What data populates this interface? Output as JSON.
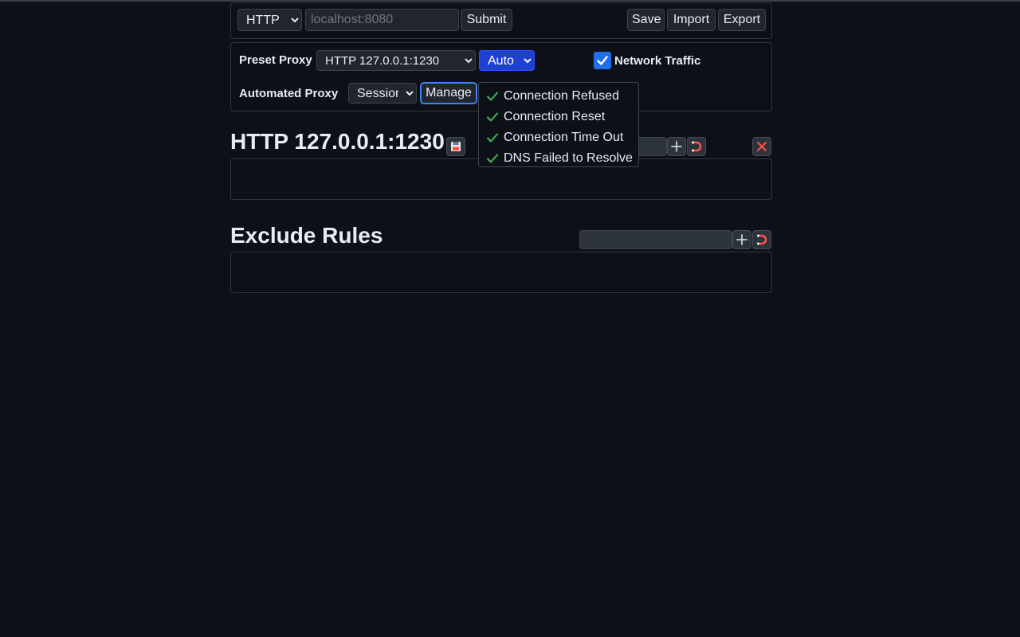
{
  "toolbar": {
    "protocol_selected": "HTTP",
    "host_placeholder": "localhost:8080",
    "host_value": "",
    "submit_label": "Submit",
    "save_label": "Save",
    "import_label": "Import",
    "export_label": "Export"
  },
  "settings": {
    "preset_proxy_label": "Preset Proxy",
    "preset_proxy_selected": "HTTP 127.0.0.1:1230",
    "mode_selected": "Auto",
    "network_traffic_label": "Network Traffic",
    "network_traffic_checked": true,
    "automated_proxy_label": "Automated Proxy",
    "automated_proxy_selected": "Session",
    "manage_label": "Manage"
  },
  "manage_menu": {
    "items": [
      {
        "label": "Connection Refused",
        "checked": true
      },
      {
        "label": "Connection Reset",
        "checked": true
      },
      {
        "label": "Connection Time Out",
        "checked": true
      },
      {
        "label": "DNS Failed to Resolve",
        "checked": true
      }
    ]
  },
  "proxy_section": {
    "title": "HTTP 127.0.0.1:1230"
  },
  "exclude_section": {
    "title": "Exclude Rules"
  },
  "colors": {
    "background": "#0d1117",
    "accent": "#1f6feb",
    "auto_select": "#1f3fd1",
    "check_green": "#3fb950",
    "danger_red": "#f85149"
  },
  "icons": {
    "save": "floppy-disk-icon",
    "add": "plus-icon",
    "magnet": "magnet-icon",
    "delete": "close-icon",
    "check": "checkmark-icon"
  }
}
